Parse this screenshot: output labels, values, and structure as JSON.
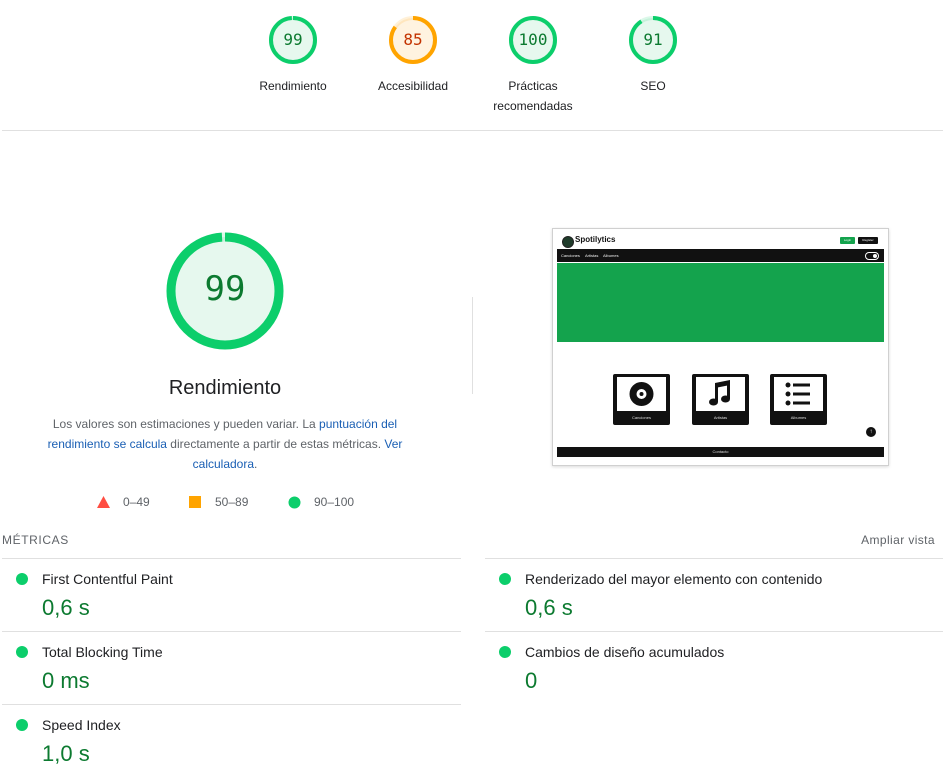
{
  "summary_gauges": [
    {
      "score": "99",
      "label": "Rendimiento",
      "color": "#0cce6b",
      "text_color": "#0c7a30",
      "fill": 0.99
    },
    {
      "score": "85",
      "label": "Accesibilidad",
      "color": "#ffa400",
      "text_color": "#c33300",
      "fill": 0.85
    },
    {
      "score": "100",
      "label": "Prácticas recomendadas",
      "color": "#0cce6b",
      "text_color": "#0c7a30",
      "fill": 1.0
    },
    {
      "score": "91",
      "label": "SEO",
      "color": "#0cce6b",
      "text_color": "#0c7a30",
      "fill": 0.91
    }
  ],
  "performance": {
    "score": "99",
    "title": "Rendimiento",
    "description_part1": "Los valores son estimaciones y pueden variar. La ",
    "link_calc": "puntuación del rendimiento se calcula",
    "description_part2": " directamente a partir de estas métricas. ",
    "link_calculator": "Ver calculadora",
    "description_end": "."
  },
  "legend": [
    {
      "range": "0–49",
      "shape": "triangle",
      "color": "#ff4e42"
    },
    {
      "range": "50–89",
      "shape": "square",
      "color": "#ffa400"
    },
    {
      "range": "90–100",
      "shape": "circle",
      "color": "#0cce6b"
    }
  ],
  "screenshot": {
    "brand": "Spotilytics",
    "login": "Login",
    "register": "Register",
    "nav": [
      "Canciones",
      "Artistas",
      "Albumes"
    ],
    "cards": [
      {
        "label": "Canciones",
        "icon": "disc-icon"
      },
      {
        "label": "Artistas",
        "icon": "music-note-icon"
      },
      {
        "label": "Albumes",
        "icon": "list-icon"
      }
    ],
    "fab": "↑",
    "footer": "Contacto",
    "hero_color": "#14a34d"
  },
  "metrics": {
    "title": "MÉTRICAS",
    "expand": "Ampliar vista",
    "items": [
      {
        "name": "First Contentful Paint",
        "value": "0,6 s"
      },
      {
        "name": "Renderizado del mayor elemento con contenido",
        "value": "0,6 s"
      },
      {
        "name": "Total Blocking Time",
        "value": "0 ms"
      },
      {
        "name": "Cambios de diseño acumulados",
        "value": "0"
      },
      {
        "name": "Speed Index",
        "value": "1,0 s"
      }
    ]
  }
}
